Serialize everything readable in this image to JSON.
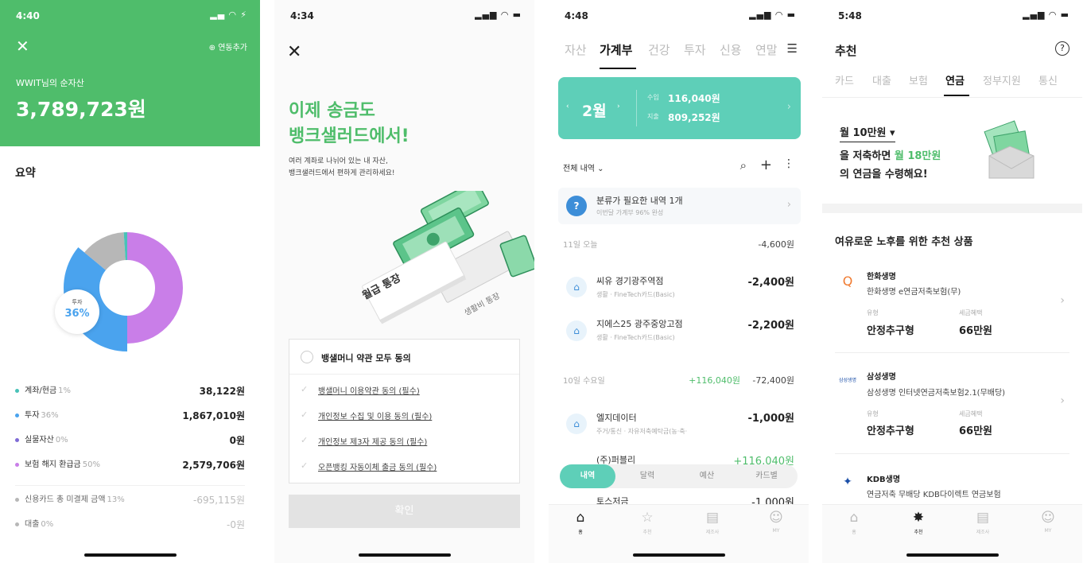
{
  "screen1": {
    "status_time": "4:40",
    "close_icon": "close-icon",
    "add_link": "연동추가",
    "net_worth_label": "WWIT님의 순자산",
    "net_worth_value": "3,789,723원",
    "summary_title": "요약",
    "donut_label": "투자",
    "donut_pct": "36%",
    "donut_segments": [
      {
        "name": "보험 해지 환급금",
        "pct": 50,
        "color": "#c97ee8"
      },
      {
        "name": "투자",
        "pct": 36,
        "color": "#4aa3ee"
      },
      {
        "name": "신용카드",
        "pct": 13,
        "color": "#b7b7b7"
      },
      {
        "name": "계좌/현금",
        "pct": 1,
        "color": "#49c2b8"
      }
    ],
    "legend": [
      {
        "label": "계좌/현금",
        "pct": "1%",
        "value": "38,122원",
        "color": "#49c2b8"
      },
      {
        "label": "투자",
        "pct": "36%",
        "value": "1,867,010원",
        "color": "#4aa3ee"
      },
      {
        "label": "실물자산",
        "pct": "0%",
        "value": "0원",
        "color": "#7f6bd6"
      },
      {
        "label": "보험 해지 환급금",
        "pct": "50%",
        "value": "2,579,706원",
        "color": "#c97ee8"
      }
    ],
    "legend_dim": [
      {
        "label": "신용카드 총 미결제 금액",
        "pct": "13%",
        "value": "-695,115원",
        "color": "#b7b7b7"
      },
      {
        "label": "대출",
        "pct": "0%",
        "value": "-0원",
        "color": "#b7b7b7"
      }
    ]
  },
  "screen2": {
    "status_time": "4:34",
    "headline_1": "이제 송금도",
    "headline_2": "뱅크샐러드에서!",
    "sub_1": "여러 계좌로 나뉘어 있는 내 자산,",
    "sub_2": "뱅크샐러드에서 편하게 관리하세요!",
    "card_label_1": "월급 통장",
    "card_label_2": "생활비 통장",
    "agree_all": "뱅샐머니 약관 모두 동의",
    "consents": [
      "뱅샐머니 이용약관 동의 (필수)",
      "개인정보 수집 및 이용 동의 (필수)",
      "개인정보 제3자 제공 동의 (필수)",
      "오픈뱅킹 자동이체 출금 동의 (필수)"
    ],
    "confirm": "확인"
  },
  "screen3": {
    "status_time": "4:48",
    "tabs": [
      "자산",
      "가계부",
      "건강",
      "투자",
      "신용",
      "연말"
    ],
    "month": "2월",
    "income_label": "수입",
    "income_value": "116,040원",
    "expense_label": "지출",
    "expense_value": "809,252원",
    "filter": "전체 내역",
    "pending_title": "분류가 필요한 내역 1개",
    "pending_sub": "이번달 가계부 96% 완성",
    "day1": "11일 오늘",
    "day1_total": "-4,600원",
    "tx1_title": "씨유 경기광주역점",
    "tx1_sub": "생활 · FineTech카드(Basic)",
    "tx1_amt": "-2,400원",
    "tx2_title": "지에스25 광주중앙고점",
    "tx2_sub": "생활 · FineTech카드(Basic)",
    "tx2_amt": "-2,200원",
    "day2": "10일 수요일",
    "day2_income": "+116,040원",
    "day2_total": "-72,400원",
    "tx3_title": "엘지데이터",
    "tx3_sub": "주거/통신 · 자유저축예탁금(농·축·",
    "tx3_amt": "-1,000원",
    "tx4_title": "(주)퍼블리",
    "tx4_amt": "+116,040원",
    "tx5_title": "토스저금",
    "tx5_amt": "-1,000원",
    "segments": [
      "내역",
      "달력",
      "예산",
      "카드별"
    ],
    "nav": [
      "홈",
      "추천",
      "제조사",
      "MY"
    ]
  },
  "screen4": {
    "status_time": "5:48",
    "title": "추천",
    "tabs": [
      "카드",
      "대출",
      "보험",
      "연금",
      "정부지원",
      "통신"
    ],
    "banner_select": "월 10만원",
    "banner_l2a": "을 저축하면 ",
    "banner_l2b": "월 18만원",
    "banner_l3": "의 연금을 수령해요!",
    "section_title": "여유로운 노후를 위한 추천 상품",
    "products": [
      {
        "company": "한화생명",
        "desc": "한화생명 e연금저축보험(무)",
        "type_label": "유형",
        "type": "안정추구형",
        "tax_label": "세금혜택",
        "tax": "66만원",
        "logo_text": "Q"
      },
      {
        "company": "삼성생명",
        "desc": "삼성생명 인터넷연금저축보험2.1(무배당)",
        "type_label": "유형",
        "type": "안정추구형",
        "tax_label": "세금혜택",
        "tax": "66만원",
        "logo_text": "삼성생명"
      },
      {
        "company": "KDB생명",
        "desc": "연금저축 무배당 KDB다이렉트 연금보험",
        "logo_text": "KDB"
      }
    ],
    "nav": [
      "홈",
      "추천",
      "제조사",
      "MY"
    ]
  }
}
